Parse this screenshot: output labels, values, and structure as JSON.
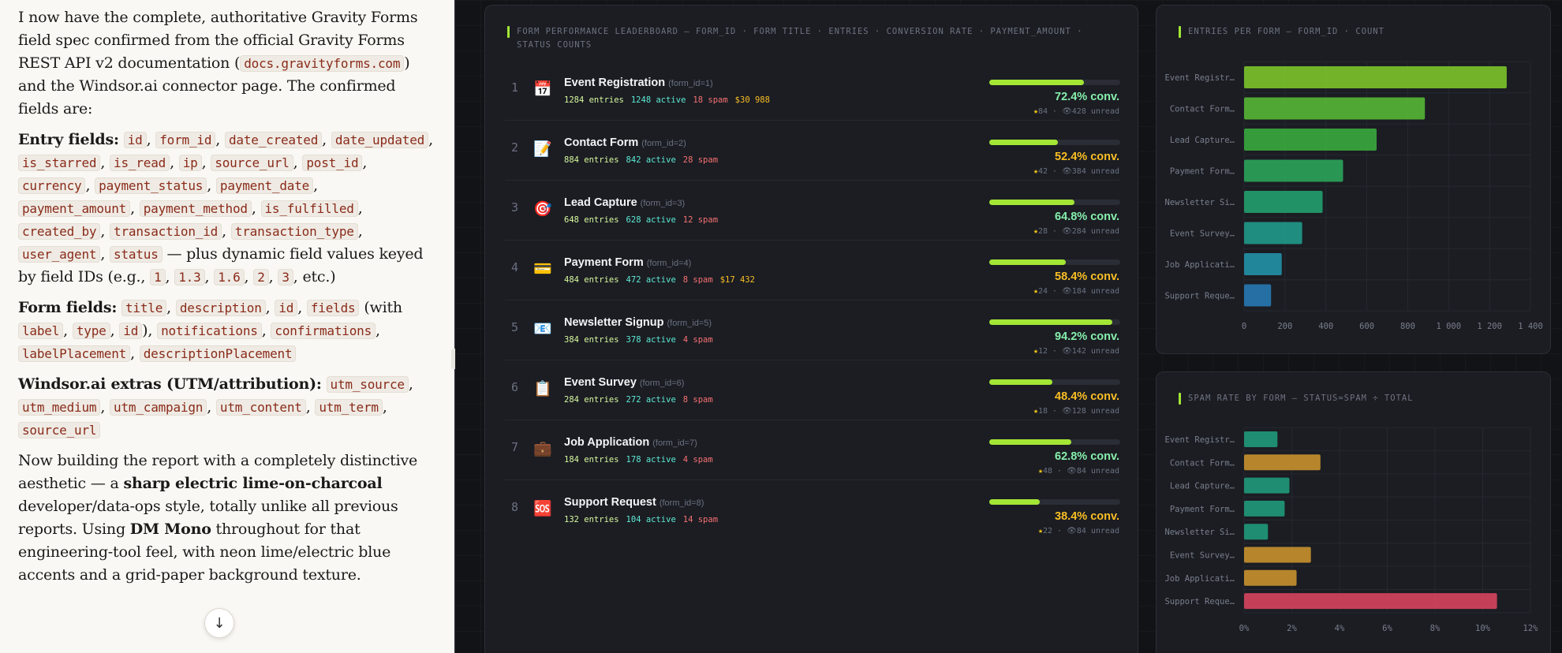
{
  "left": {
    "p1_a": "I now have the complete, authoritative Gravity Forms field spec confirmed from the official Gravity Forms REST API v2 documentation (",
    "p1_code": "docs.gravityforms.com",
    "p1_b": ") and the Windsor.ai connector page. The confirmed fields are:",
    "entry_label": "Entry fields:",
    "entry_fields": [
      "id",
      "form_id",
      "date_created",
      "date_updated",
      "is_starred",
      "is_read",
      "ip",
      "source_url",
      "post_id",
      "currency",
      "payment_status",
      "payment_date",
      "payment_amount",
      "payment_method",
      "is_fulfilled",
      "created_by",
      "transaction_id",
      "transaction_type",
      "user_agent",
      "status"
    ],
    "entry_suffix_a": " — plus dynamic field values keyed by field IDs (e.g., ",
    "entry_ids": [
      "1",
      "1.3",
      "1.6",
      "2",
      "3"
    ],
    "entry_suffix_b": ", etc.)",
    "form_label": "Form fields:",
    "form_fields_a": [
      "title",
      "description",
      "id",
      "fields"
    ],
    "form_with": "(with ",
    "form_sub": [
      "label",
      "type",
      "id"
    ],
    "form_close": "),",
    "form_fields_b": [
      "notifications",
      "confirmations",
      "labelPlacement",
      "descriptionPlacement"
    ],
    "windsor_label": "Windsor.ai extras (UTM/attribution):",
    "windsor_fields": [
      "utm_source",
      "utm_medium",
      "utm_campaign",
      "utm_content",
      "utm_term",
      "source_url"
    ],
    "p4_a": "Now building the report with a completely distinctive aesthetic — a ",
    "p4_b": "sharp electric lime-on-charcoal",
    "p4_c": " developer/data-ops style, totally unlike all previous reports. Using ",
    "p4_d": "DM Mono",
    "p4_e": " throughout for that engineering-tool feel, with neon lime/electric blue accents and a grid-paper background texture.",
    "scroll_icon": "arrow-down-icon"
  },
  "leaderboard": {
    "title": "FORM PERFORMANCE LEADERBOARD — FORM_ID · FORM TITLE · ENTRIES · CONVERSION RATE · PAYMENT_AMOUNT · STATUS COUNTS",
    "rows": [
      {
        "rank": "1",
        "icon": "📅",
        "icon_name": "calendar-icon",
        "name": "Event Registration",
        "fid": "(form_id=1)",
        "entries": "1284 entries",
        "active": "1248 active",
        "spam": "18 spam",
        "pay": "$30 988",
        "conv": "72.4% conv.",
        "conv_pct": 72.4,
        "stars": "84",
        "unread": "428 unread",
        "hi": true
      },
      {
        "rank": "2",
        "icon": "📝",
        "icon_name": "memo-icon",
        "name": "Contact Form",
        "fid": "(form_id=2)",
        "entries": "884 entries",
        "active": "842 active",
        "spam": "28 spam",
        "pay": "",
        "conv": "52.4% conv.",
        "conv_pct": 52.4,
        "stars": "42",
        "unread": "384 unread",
        "hi": false
      },
      {
        "rank": "3",
        "icon": "🎯",
        "icon_name": "target-icon",
        "name": "Lead Capture",
        "fid": "(form_id=3)",
        "entries": "648 entries",
        "active": "628 active",
        "spam": "12 spam",
        "pay": "",
        "conv": "64.8% conv.",
        "conv_pct": 64.8,
        "stars": "28",
        "unread": "284 unread",
        "hi": true
      },
      {
        "rank": "4",
        "icon": "💳",
        "icon_name": "credit-card-icon",
        "name": "Payment Form",
        "fid": "(form_id=4)",
        "entries": "484 entries",
        "active": "472 active",
        "spam": "8 spam",
        "pay": "$17 432",
        "conv": "58.4% conv.",
        "conv_pct": 58.4,
        "stars": "24",
        "unread": "184 unread",
        "hi": false
      },
      {
        "rank": "5",
        "icon": "📧",
        "icon_name": "email-icon",
        "name": "Newsletter Signup",
        "fid": "(form_id=5)",
        "entries": "384 entries",
        "active": "378 active",
        "spam": "4 spam",
        "pay": "",
        "conv": "94.2% conv.",
        "conv_pct": 94.2,
        "stars": "12",
        "unread": "142 unread",
        "hi": true
      },
      {
        "rank": "6",
        "icon": "📋",
        "icon_name": "clipboard-icon",
        "name": "Event Survey",
        "fid": "(form_id=6)",
        "entries": "284 entries",
        "active": "272 active",
        "spam": "8 spam",
        "pay": "",
        "conv": "48.4% conv.",
        "conv_pct": 48.4,
        "stars": "18",
        "unread": "128 unread",
        "hi": false
      },
      {
        "rank": "7",
        "icon": "💼",
        "icon_name": "briefcase-icon",
        "name": "Job Application",
        "fid": "(form_id=7)",
        "entries": "184 entries",
        "active": "178 active",
        "spam": "4 spam",
        "pay": "",
        "conv": "62.8% conv.",
        "conv_pct": 62.8,
        "stars": "48",
        "unread": "84 unread",
        "hi": true
      },
      {
        "rank": "8",
        "icon": "🆘",
        "icon_name": "sos-icon",
        "name": "Support Request",
        "fid": "(form_id=8)",
        "entries": "132 entries",
        "active": "104 active",
        "spam": "14 spam",
        "pay": "",
        "conv": "38.4% conv.",
        "conv_pct": 38.4,
        "stars": "22",
        "unread": "84 unread",
        "hi": false
      }
    ],
    "star_icon": "★",
    "eye_icon": "👁"
  },
  "chart_data": [
    {
      "type": "bar",
      "title": "ENTRIES PER FORM — FORM_ID · COUNT",
      "orientation": "horizontal",
      "categories": [
        "Event Registr…",
        "Contact Form…",
        "Lead Capture…",
        "Payment Form…",
        "Newsletter Si…",
        "Event Survey…",
        "Job Applicati…",
        "Support Reque…"
      ],
      "values": [
        1284,
        884,
        648,
        484,
        384,
        284,
        184,
        132
      ],
      "xlim": [
        0,
        1400
      ],
      "ticks": [
        "0",
        "200",
        "400",
        "600",
        "800",
        "1 000",
        "1 200",
        "1 400"
      ],
      "colors": [
        "#7cc42b",
        "#56b735",
        "#3aaa3e",
        "#2ca45a",
        "#22a06e",
        "#209a8a",
        "#2492a8",
        "#2779b2"
      ],
      "grid": true
    },
    {
      "type": "bar",
      "title": "SPAM RATE BY FORM — STATUS=SPAM ÷ TOTAL",
      "orientation": "horizontal",
      "categories": [
        "Event Registr…",
        "Contact Form…",
        "Lead Capture…",
        "Payment Form…",
        "Newsletter Si…",
        "Event Survey…",
        "Job Applicati…",
        "Support Reque…"
      ],
      "values": [
        1.4,
        3.2,
        1.9,
        1.7,
        1.0,
        2.8,
        2.2,
        10.6
      ],
      "xlim": [
        0,
        12
      ],
      "ticks": [
        "0%",
        "2%",
        "4%",
        "6%",
        "8%",
        "10%",
        "12%"
      ],
      "colors": [
        "#209a7a",
        "#c9922e",
        "#209a7a",
        "#209a7a",
        "#209a7a",
        "#c9922e",
        "#c9922e",
        "#d6455e"
      ],
      "grid": true
    }
  ]
}
